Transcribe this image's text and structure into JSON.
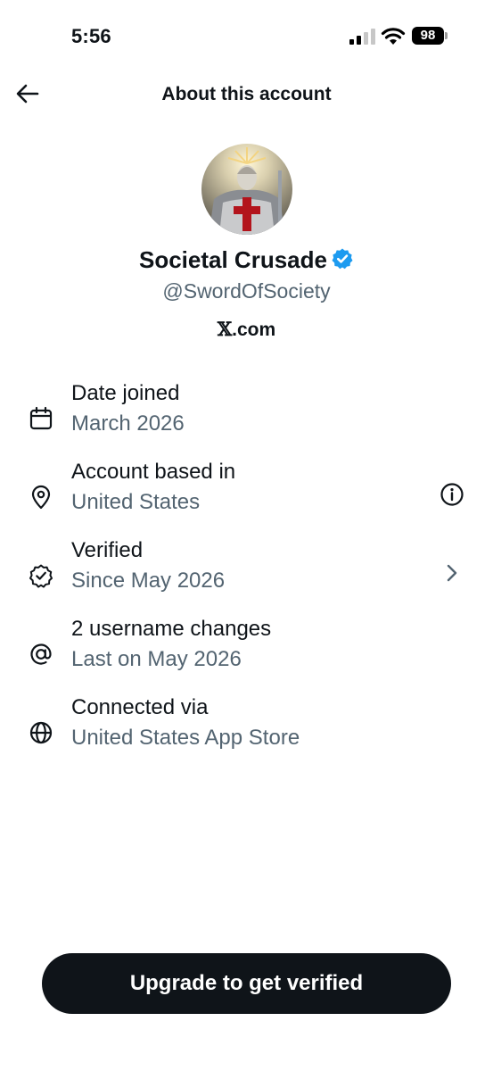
{
  "status_bar": {
    "time": "5:56",
    "battery": "98"
  },
  "header": {
    "title": "About this account"
  },
  "profile": {
    "display_name": "Societal Crusade",
    "handle": "@SwordOfSociety",
    "verified_badge_color": "#1d9bf0",
    "avatar_icon": "crusader-knight-avatar",
    "domain_glyph": "𝕏",
    "domain_text": ".com"
  },
  "details": [
    {
      "icon": "calendar-icon",
      "title": "Date joined",
      "subtitle": "March 2026",
      "action": null
    },
    {
      "icon": "location-pin-icon",
      "title": "Account based in",
      "subtitle": "United States",
      "action": "info-icon"
    },
    {
      "icon": "verified-badge-icon",
      "title": "Verified",
      "subtitle": "Since May 2026",
      "action": "chevron-right-icon"
    },
    {
      "icon": "at-sign-icon",
      "title": "2 username changes",
      "subtitle": "Last on May 2026",
      "action": null
    },
    {
      "icon": "globe-icon",
      "title": "Connected via",
      "subtitle": "United States App Store",
      "action": null
    }
  ],
  "cta": {
    "label": "Upgrade to get verified"
  },
  "colors": {
    "text_primary": "#0f1419",
    "text_secondary": "#536471",
    "button_bg": "#0f1419"
  }
}
